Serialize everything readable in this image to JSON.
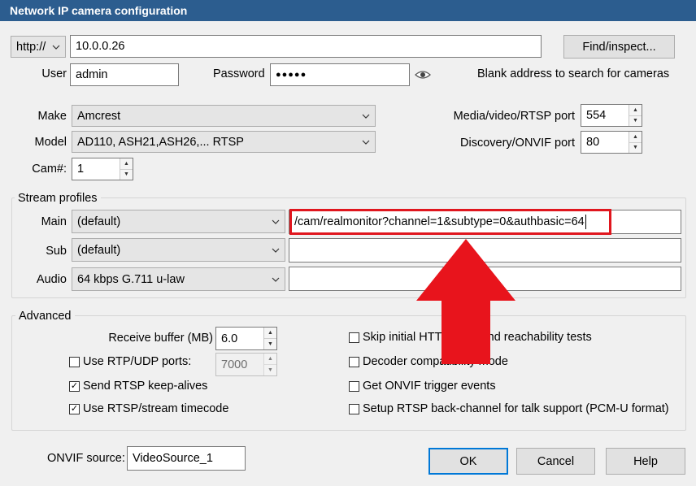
{
  "window": {
    "title": "Network IP camera configuration"
  },
  "connection": {
    "protocol": "http://",
    "address": "10.0.0.26",
    "find_button": "Find/inspect...",
    "user_label": "User",
    "user": "admin",
    "password_label": "Password",
    "password_mask": "●●●●●",
    "hint": "Blank address to search for cameras"
  },
  "camera": {
    "make_label": "Make",
    "make": "Amcrest",
    "model_label": "Model",
    "model": "AD110, ASH21,ASH26,... RTSP",
    "cam_label": "Cam#:",
    "cam": "1",
    "media_port_label": "Media/video/RTSP port",
    "media_port": "554",
    "onvif_port_label": "Discovery/ONVIF port",
    "onvif_port": "80"
  },
  "stream_profiles": {
    "title": "Stream profiles",
    "main_label": "Main",
    "main_profile": "(default)",
    "main_path": "/cam/realmonitor?channel=1&subtype=0&authbasic=64",
    "sub_label": "Sub",
    "sub_profile": "(default)",
    "sub_path": "",
    "audio_label": "Audio",
    "audio_profile": "64 kbps G.711 u-law",
    "audio_path": ""
  },
  "advanced": {
    "title": "Advanced",
    "receive_buffer_label": "Receive buffer (MB)",
    "receive_buffer": "6.0",
    "use_rtp_label": "Use RTP/UDP ports:",
    "use_rtp_checked": false,
    "rtp_port": "7000",
    "keepalive_label": "Send RTSP keep-alives",
    "keepalive_checked": true,
    "timecode_label": "Use RTSP/stream timecode",
    "timecode_checked": true,
    "skip_tests_label": "Skip initial HTTP DNS and reachability tests",
    "skip_tests_checked": false,
    "decoder_label": "Decoder compatibility mode",
    "decoder_checked": false,
    "onvif_events_label": "Get ONVIF trigger events",
    "onvif_events_checked": false,
    "backchannel_label": "Setup RTSP back-channel for talk support (PCM-U format)",
    "backchannel_checked": false
  },
  "footer": {
    "onvif_source_label": "ONVIF source:",
    "onvif_source": "VideoSource_1",
    "ok": "OK",
    "cancel": "Cancel",
    "help": "Help"
  },
  "colors": {
    "titlebar": "#2c5d8f",
    "highlight_box": "#e0161e",
    "arrow": "#e8141c",
    "default_button_border": "#0078d7"
  }
}
